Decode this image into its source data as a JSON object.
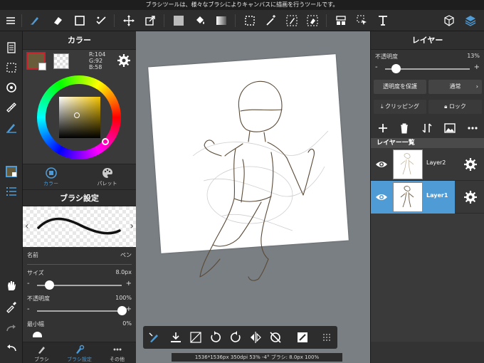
{
  "tooltip": "ブラシツールは、様々なブラシによりキャンバスに描画を行うツールです。",
  "toolbar": {
    "icons": [
      "menu-icon",
      "brush-icon",
      "eraser-icon",
      "rectangle-icon",
      "brush-toggle-icon",
      "move-icon",
      "transform-icon",
      "fill-color-icon",
      "bucket-icon",
      "gradient-icon",
      "select-icon",
      "magic-wand-icon",
      "select-pen-icon",
      "select-eraser-icon",
      "layout-icon",
      "select-move-icon",
      "text-icon",
      "3d-cube-icon",
      "layers-icon"
    ]
  },
  "left_strip": {
    "icons": [
      "pages-icon",
      "selection-icon",
      "rotate-icon",
      "ruler-icon",
      "snap-icon",
      "color-panel-icon",
      "list-icon",
      "hand-icon",
      "eyedropper-icon",
      "redo-icon",
      "undo-icon"
    ]
  },
  "color_panel": {
    "title": "カラー",
    "main_color": "#685c3a",
    "rgb_r": "R:104",
    "rgb_g": "G:92",
    "rgb_b": "B:58",
    "tabs": [
      {
        "label": "カラー",
        "icon": "color-wheel-icon",
        "active": true
      },
      {
        "label": "パレット",
        "icon": "palette-icon",
        "active": false
      }
    ]
  },
  "brush_panel": {
    "title": "ブラシ設定",
    "name_label": "名前",
    "name_value": "ペン",
    "size_label": "サイズ",
    "size_value": "8.0px",
    "size_fraction": 0.14,
    "opacity_label": "不透明度",
    "opacity_value": "100%",
    "opacity_fraction": 1.0,
    "min_width_label": "最小幅",
    "min_width_value": "0%",
    "min_width_fraction": 0.0,
    "minus": "-",
    "plus": "+"
  },
  "bottom_tabs": [
    {
      "label": "ブラシ",
      "icon": "brush-icon",
      "active": false
    },
    {
      "label": "ブラシ設定",
      "icon": "brush-settings-icon",
      "active": true
    },
    {
      "label": "その他",
      "icon": "more-icon",
      "active": false
    }
  ],
  "canvas": {
    "status": "1536*1536px 350dpi 53% -4° ブラシ: 8.0px 100%",
    "bottom_icons": [
      "brush-stabilizer-icon",
      "import-icon",
      "crop-icon",
      "rotate-left-icon",
      "rotate-right-icon",
      "flip-icon",
      "no-rotate-icon",
      "snapshot-icon",
      "grid-icon"
    ]
  },
  "layer_panel": {
    "title": "レイヤー",
    "opacity_label": "不透明度",
    "opacity_value": "13%",
    "opacity_fraction": 0.13,
    "minus": "-",
    "plus": "+",
    "protect_alpha": "透明度を保護",
    "blend_mode": "通常",
    "clipping": "クリッピング",
    "lock": "ロック",
    "list_title": "レイヤー一覧",
    "layers": [
      {
        "name": "Layer2",
        "selected": false
      },
      {
        "name": "Layer1",
        "selected": true
      }
    ]
  },
  "colors": {
    "accent": "#4e9bd6",
    "bg": "#2d2d2d",
    "canvas_bg": "#7a7f84"
  }
}
